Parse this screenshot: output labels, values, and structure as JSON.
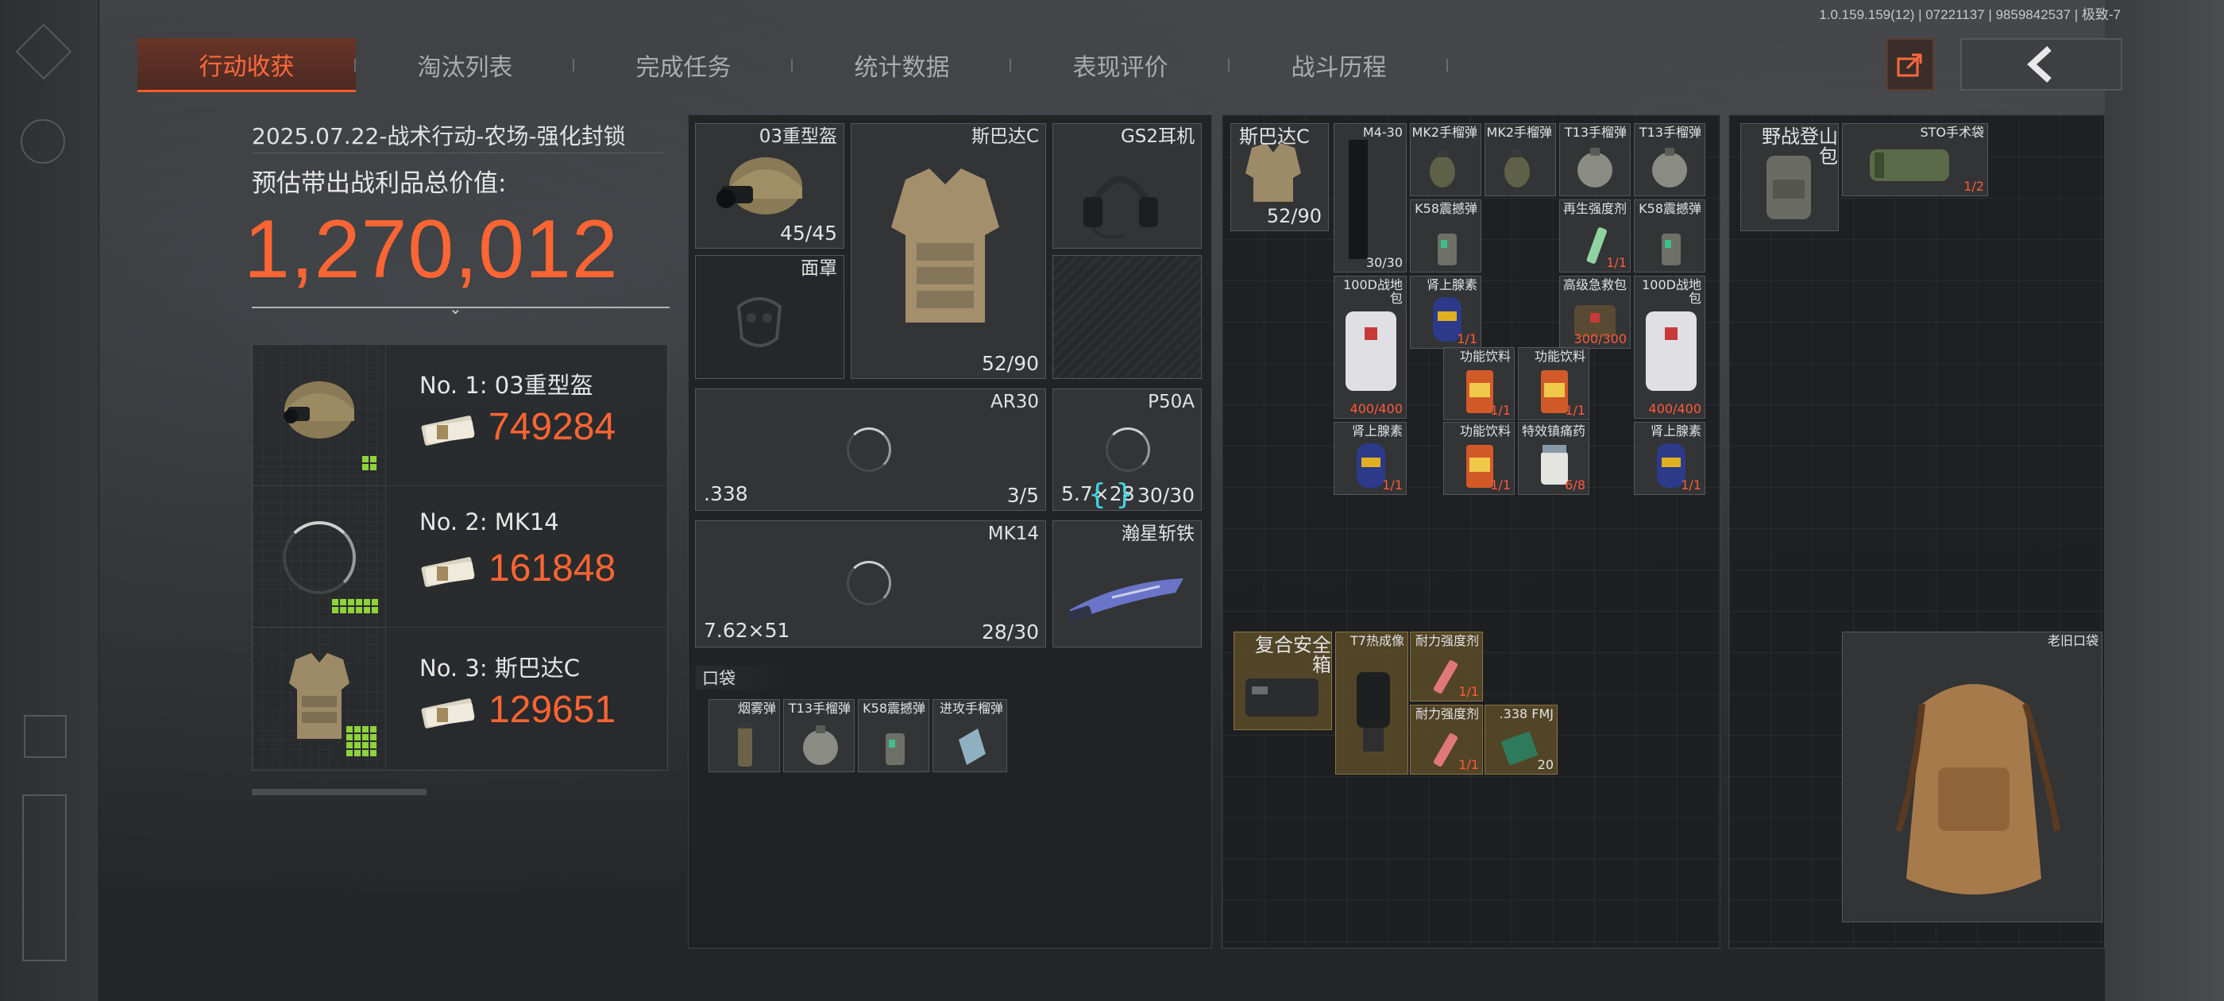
{
  "header": {
    "version": "1.0.159.159(12) | 07221137 | 9859842537 | 极致-7",
    "tabs": [
      {
        "label": "行动收获",
        "active": true
      },
      {
        "label": "淘汰列表",
        "active": false
      },
      {
        "label": "完成任务",
        "active": false
      },
      {
        "label": "统计数据",
        "active": false
      },
      {
        "label": "表现评价",
        "active": false
      },
      {
        "label": "战斗历程",
        "active": false
      }
    ],
    "share_icon": "share-icon",
    "back_icon": "chevron-left-icon"
  },
  "summary": {
    "operation": "2025.07.22-战术行动-农场-强化封锁",
    "value_label": "预估带出战利品总价值:",
    "total_value": "1,270,012",
    "top_items": [
      {
        "name": "No. 1: 03重型盔",
        "value": "749284",
        "icon": "helmet-icon"
      },
      {
        "name": "No. 2: MK14",
        "value": "161848",
        "icon": "loading-spinner-icon"
      },
      {
        "name": "No. 3: 斯巴达C",
        "value": "129651",
        "icon": "body-armor-icon"
      }
    ]
  },
  "equipment": {
    "helmet": {
      "label": "03重型盔",
      "count": "45/45"
    },
    "armor": {
      "label": "斯巴达C",
      "count": "52/90"
    },
    "headset": {
      "label": "GS2耳机"
    },
    "mask": {
      "label": "面罩"
    },
    "weapon1": {
      "label": "AR30",
      "ammo": ".338",
      "count": "3/5"
    },
    "pistol": {
      "label": "P50A",
      "ammo": "5.7×28",
      "count": "30/30"
    },
    "weapon2": {
      "label": "MK14",
      "ammo": "7.62×51",
      "count": "28/30"
    },
    "melee": {
      "label": "瀚星斩铁"
    },
    "pocket_label": "口袋",
    "pockets": [
      "烟雾弹",
      "T13手榴弹",
      "K58震撼弹",
      "进攻手榴弹"
    ]
  },
  "rig": {
    "name": "斯巴达C",
    "count": "52/90",
    "items": [
      {
        "label": "M4-30",
        "count": "30/30"
      },
      {
        "label": "MK2手榴弹"
      },
      {
        "label": "MK2手榴弹"
      },
      {
        "label": "T13手榴弹"
      },
      {
        "label": "T13手榴弹"
      },
      {
        "label": "K58震撼弹"
      },
      {
        "label": "再生强度剂",
        "count": "1/1"
      },
      {
        "label": "K58震撼弹"
      },
      {
        "label": "100D战地包",
        "count": "400/400"
      },
      {
        "label": "肾上腺素",
        "count": "1/1"
      },
      {
        "label": "高级急救包",
        "count": "300/300"
      },
      {
        "label": "100D战地包",
        "count": "400/400"
      },
      {
        "label": "功能饮料",
        "count": "1/1"
      },
      {
        "label": "功能饮料",
        "count": "1/1"
      },
      {
        "label": "肾上腺素",
        "count": "1/1"
      },
      {
        "label": "功能饮料",
        "count": "1/1"
      },
      {
        "label": "特效镇痛药",
        "count": "6/8"
      },
      {
        "label": "肾上腺素",
        "count": "1/1"
      }
    ],
    "safebox": {
      "label": "复合安全箱"
    },
    "safebox_items": [
      {
        "label": "T7热成像"
      },
      {
        "label": "耐力强度剂",
        "count": "1/1"
      },
      {
        "label": "耐力强度剂",
        "count": "1/1"
      },
      {
        "label": ".338 FMJ",
        "count": "20"
      }
    ]
  },
  "backpack": {
    "name": "野战登山包",
    "sto": {
      "label": "STO手术袋",
      "count": "1/2"
    },
    "old_bag": {
      "label": "老旧口袋"
    }
  },
  "colors": {
    "accent": "#ff6532",
    "tab_active_bg": "#5a2e25",
    "indicator_green": "#8fd33a"
  }
}
